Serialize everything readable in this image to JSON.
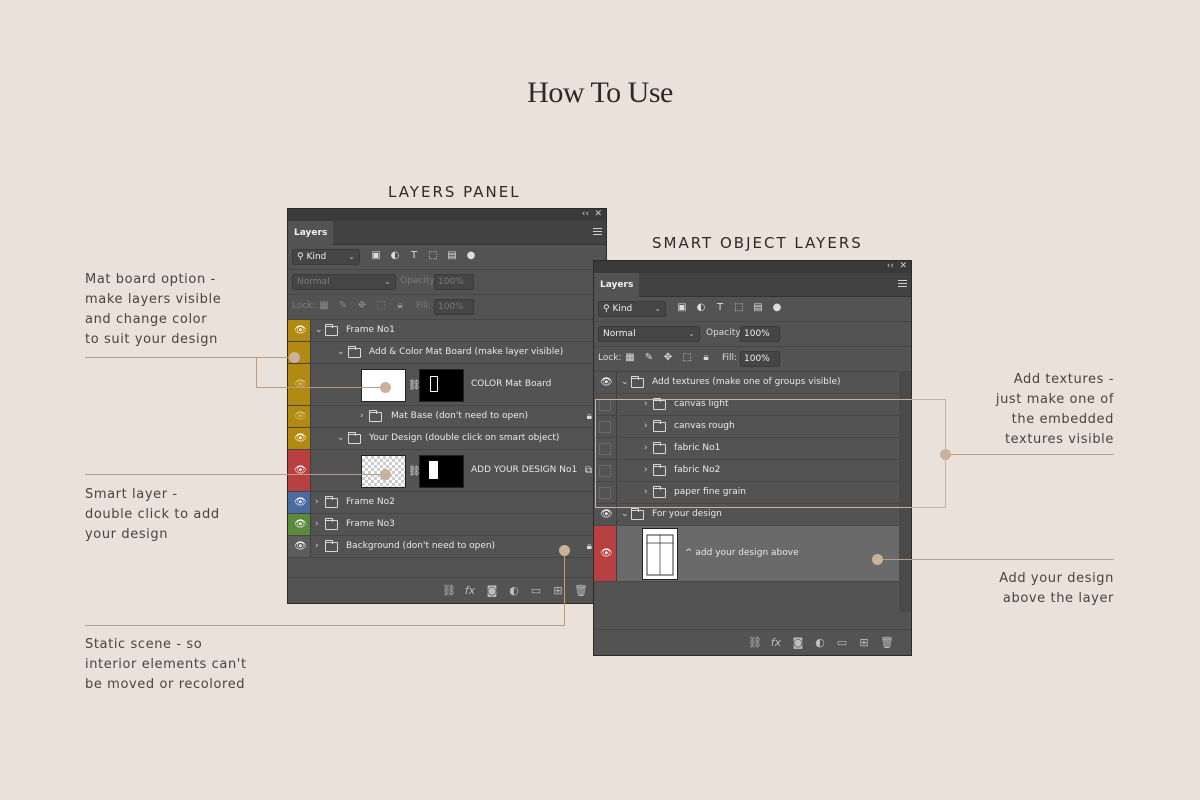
{
  "page": {
    "title": "How To Use",
    "headings": {
      "layers_panel": "LAYERS PANEL",
      "smart_object_layers": "SMART OBJECT LAYERS"
    }
  },
  "notes": {
    "mat_board": "Mat board option -\nmake layers visible\nand change color\nto suit your design",
    "smart_layer": "Smart layer -\ndouble click to add\nyour design",
    "static_scene": "Static scene - so\ninterior elements can't\nbe moved or recolored",
    "add_textures": "Add textures -\njust make one of\nthe embedded\ntextures visible",
    "add_design": "Add your design\nabove the layer"
  },
  "panel": {
    "tab": "Layers",
    "filter": "Kind",
    "blend_mode": "Normal",
    "opacity_label": "Opacity:",
    "opacity": "100%",
    "lock_label": "Lock:",
    "fill_label": "Fill:",
    "fill": "100%"
  },
  "left_panel": {
    "layers": [
      {
        "name": "Frame No1"
      },
      {
        "name": "Add & Color Mat Board (make layer visible)"
      },
      {
        "name": "COLOR Mat Board"
      },
      {
        "name": "Mat Base (don't need to open)"
      },
      {
        "name": "Your Design (double click on smart object)"
      },
      {
        "name": "ADD YOUR DESIGN No1"
      },
      {
        "name": "Frame No2"
      },
      {
        "name": "Frame No3"
      },
      {
        "name": "Background (don't need to open)"
      }
    ]
  },
  "right_panel": {
    "layers": [
      {
        "name": "Add textures (make one of groups visible)"
      },
      {
        "name": "canvas light"
      },
      {
        "name": "canvas rough"
      },
      {
        "name": "fabric No1"
      },
      {
        "name": "fabric No2"
      },
      {
        "name": "paper fine grain"
      },
      {
        "name": "For your design"
      },
      {
        "name": "^ add your design above"
      }
    ]
  },
  "colors": {
    "background": "#e9e1da",
    "yellow_tag": "#b28a12",
    "red_tag": "#b94040",
    "blue_tag": "#4a6aa0",
    "green_tag": "#5a8a3c",
    "accent": "#c9b19a"
  },
  "icons": {
    "eye": "eye-icon",
    "folder": "folder-icon",
    "lock": "lock-icon",
    "link": "link-icon",
    "fx": "fx-icon",
    "trash": "trash-icon"
  }
}
